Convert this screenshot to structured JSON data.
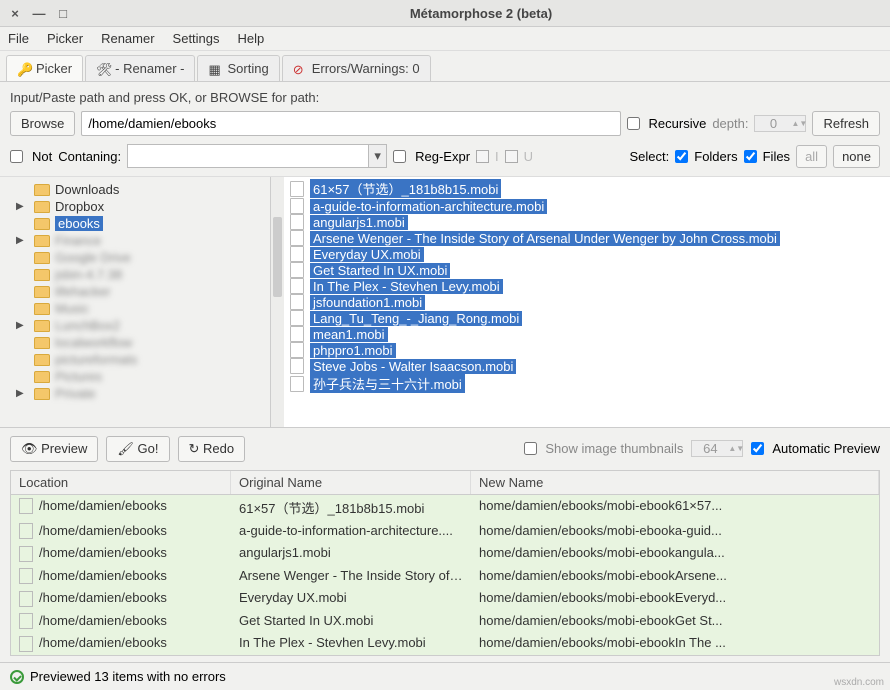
{
  "window": {
    "title": "Métamorphose 2 (beta)"
  },
  "menu": {
    "file": "File",
    "picker": "Picker",
    "renamer": "Renamer",
    "settings": "Settings",
    "help": "Help"
  },
  "tabs": {
    "picker": "Picker",
    "renamer": "- Renamer -",
    "sorting": "Sorting",
    "errors": "Errors/Warnings: 0"
  },
  "path": {
    "instruction": "Input/Paste path and press OK, or BROWSE for path:",
    "browse": "Browse",
    "value": "/home/damien/ebooks",
    "recursive": "Recursive",
    "depth_label": "depth:",
    "depth_value": "0",
    "refresh": "Refresh"
  },
  "filter": {
    "not": "Not",
    "containing": "Contaning:",
    "regexpr": "Reg-Expr",
    "i": "I",
    "u": "U",
    "select": "Select:",
    "folders": "Folders",
    "files": "Files",
    "all": "all",
    "none": "none"
  },
  "tree": {
    "items": [
      {
        "label": "Downloads",
        "expand": "",
        "blur": false,
        "sel": false
      },
      {
        "label": "Dropbox",
        "expand": "▶",
        "blur": false,
        "sel": false
      },
      {
        "label": "ebooks",
        "expand": "",
        "blur": false,
        "sel": true
      },
      {
        "label": "Finance",
        "expand": "▶",
        "blur": true,
        "sel": false
      },
      {
        "label": "Google Drive",
        "expand": "",
        "blur": true,
        "sel": false
      },
      {
        "label": "jsbin-4.7.38",
        "expand": "",
        "blur": true,
        "sel": false
      },
      {
        "label": "lifehacker",
        "expand": "",
        "blur": true,
        "sel": false
      },
      {
        "label": "Music",
        "expand": "",
        "blur": true,
        "sel": false
      },
      {
        "label": "LunchBox2",
        "expand": "▶",
        "blur": true,
        "sel": false
      },
      {
        "label": "localworkflow",
        "expand": "",
        "blur": true,
        "sel": false
      },
      {
        "label": "pictureformats",
        "expand": "",
        "blur": true,
        "sel": false
      },
      {
        "label": "Pictures",
        "expand": "",
        "blur": true,
        "sel": false
      },
      {
        "label": "Private",
        "expand": "▶",
        "blur": true,
        "sel": false
      }
    ]
  },
  "files": [
    "61×57（节选）_181b8b15.mobi",
    "a-guide-to-information-architecture.mobi",
    "angularjs1.mobi",
    "Arsene Wenger - The Inside Story of Arsenal Under Wenger by John Cross.mobi",
    "Everyday UX.mobi",
    "Get Started In UX.mobi",
    "In The Plex - Stevhen Levy.mobi",
    "jsfoundation1.mobi",
    "Lang_Tu_Teng_-_Jiang_Rong.mobi",
    "mean1.mobi",
    "phppro1.mobi",
    "Steve Jobs - Walter Isaacson.mobi",
    "孙子兵法与三十六计.mobi"
  ],
  "preview": {
    "preview": "Preview",
    "go": "Go!",
    "redo": "Redo",
    "thumbs": "Show image thumbnails",
    "thumbs_size": "64",
    "auto": "Automatic Preview"
  },
  "table": {
    "headers": {
      "location": "Location",
      "original": "Original Name",
      "newname": "New Name"
    },
    "rows": [
      {
        "loc": "/home/damien/ebooks",
        "orig": "61×57（节选）_181b8b15.mobi",
        "new": "home/damien/ebooks/mobi-ebook61×57..."
      },
      {
        "loc": "/home/damien/ebooks",
        "orig": "a-guide-to-information-architecture....",
        "new": "home/damien/ebooks/mobi-ebooka-guid..."
      },
      {
        "loc": "/home/damien/ebooks",
        "orig": "angularjs1.mobi",
        "new": "home/damien/ebooks/mobi-ebookangula..."
      },
      {
        "loc": "/home/damien/ebooks",
        "orig": "Arsene Wenger - The Inside Story of ...",
        "new": "home/damien/ebooks/mobi-ebookArsene..."
      },
      {
        "loc": "/home/damien/ebooks",
        "orig": "Everyday UX.mobi",
        "new": "home/damien/ebooks/mobi-ebookEveryd..."
      },
      {
        "loc": "/home/damien/ebooks",
        "orig": "Get Started In UX.mobi",
        "new": "home/damien/ebooks/mobi-ebookGet St..."
      },
      {
        "loc": "/home/damien/ebooks",
        "orig": "In The Plex - Stevhen Levy.mobi",
        "new": "home/damien/ebooks/mobi-ebookIn The ..."
      }
    ]
  },
  "status": {
    "text": "Previewed 13 items with no errors"
  },
  "watermark": "wsxdn.com"
}
